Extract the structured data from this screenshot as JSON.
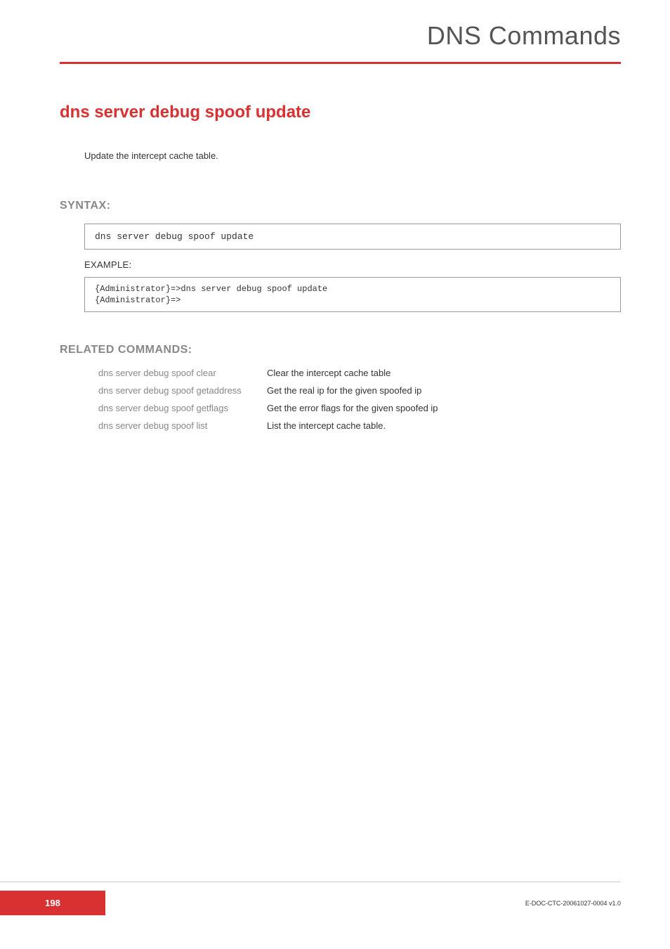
{
  "header": {
    "title": "DNS Commands"
  },
  "command": {
    "title": "dns server debug spoof update",
    "description": "Update the intercept cache table."
  },
  "syntax": {
    "heading": "SYNTAX:",
    "code": "dns server debug spoof update",
    "example_label": "EXAMPLE:",
    "example_code": "{Administrator}=>dns server debug spoof update\n{Administrator}=>"
  },
  "related": {
    "heading": "RELATED COMMANDS:",
    "rows": [
      {
        "cmd": "dns server debug spoof clear",
        "desc": "Clear the intercept cache table"
      },
      {
        "cmd": "dns server debug spoof getaddress",
        "desc": "Get the real ip for the given spoofed ip"
      },
      {
        "cmd": "dns server debug spoof getflags",
        "desc": "Get the error flags for the given spoofed ip"
      },
      {
        "cmd": "dns server debug spoof list",
        "desc": "List the intercept cache table."
      }
    ]
  },
  "footer": {
    "page_number": "198",
    "doc_id": "E-DOC-CTC-20061027-0004 v1.0"
  }
}
